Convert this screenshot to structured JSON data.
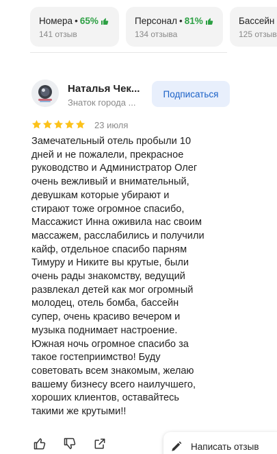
{
  "rating_cards": [
    {
      "label": "Номера",
      "percent": "65%",
      "count": "141 отзыв"
    },
    {
      "label": "Персонал",
      "percent": "81%",
      "count": "134 отзыва"
    },
    {
      "label": "Бассейн",
      "percent": "",
      "count": "125 отзыв"
    }
  ],
  "review": {
    "author_name": "Наталья Чек...",
    "author_status": "Знаток города ...",
    "subscribe_label": "Подписаться",
    "rating": 5,
    "date": "23 июля",
    "text": "Замечательный отель пробыли 10\nдней и не пожалели, прекрасное\nруководство и Администратор Олег\nочень вежливый и внимательный,\nдевушкам которые убирают и\nстирают тоже огромное спасибо,\nМассажист Инна оживила нас своим\nмассажем, расслабились и получили\nкайф, отдельное спасибо парням\nТимуру и Никите вы крутые, были\nочень рады знакомству, ведущий\nразвлекал детей как мог огромный\nмолодец, отель бомба, бассейн\nсупер, очень красиво вечером и\nмузыка поднимает настроение.\nЮжная ночь огромное спасибо за\nтакое гостеприимство! Буду\nсоветовать всем знакомым, желаю\nвашему бизнесу всего наилучшего,\nхороших клиентов, оставайтесь\nтакими же крутыми!!"
  },
  "actions": {
    "write_review_label": "Написать отзыв",
    "icons": [
      "thumbs-up-icon",
      "thumbs-down-icon",
      "share-icon",
      "pencil-icon"
    ]
  },
  "colors": {
    "accent_green": "#2da044",
    "star": "#fcc21b",
    "link_blue": "#1a61c7",
    "subscribe_bg": "#e8effc"
  }
}
